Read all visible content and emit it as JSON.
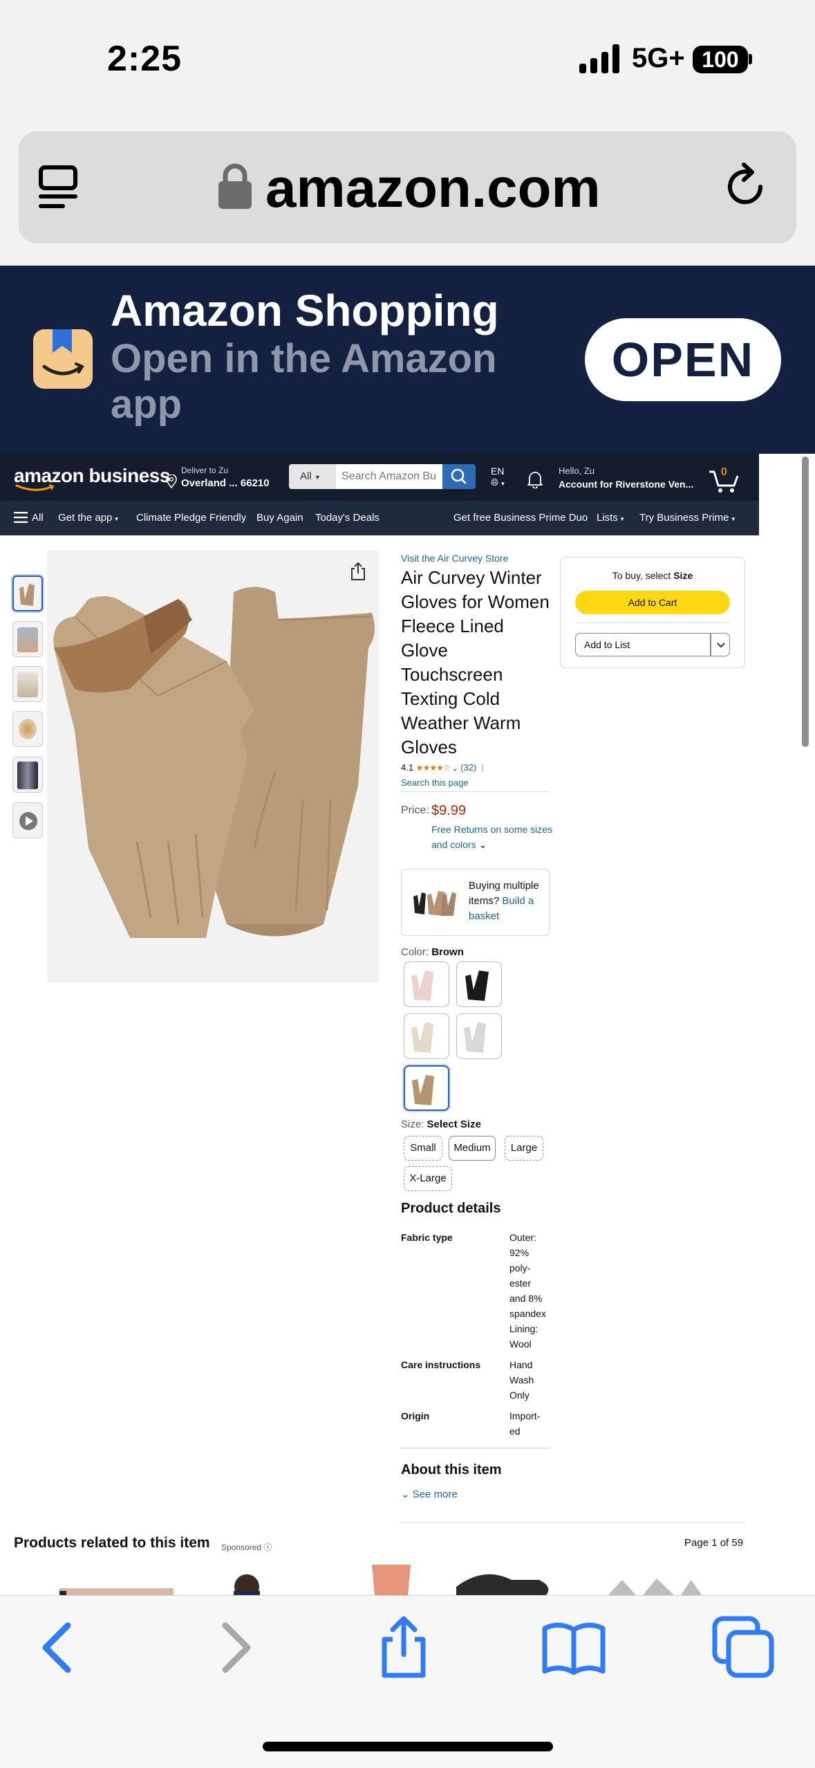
{
  "status": {
    "time": "2:25",
    "network": "5G+",
    "battery": "100"
  },
  "browser": {
    "url": "amazon.com"
  },
  "app_banner": {
    "title": "Amazon Shopping",
    "subtitle": "Open in the Amazon app",
    "open_label": "OPEN"
  },
  "header": {
    "logo": "amazon business",
    "deliver_line1": "Deliver to Zu",
    "deliver_line2": "Overland ... 66210",
    "search_category": "All",
    "search_placeholder": "Search Amazon Bu",
    "lang": "EN",
    "hello_line1": "Hello, Zu",
    "hello_line2": "Account for Riverstone Ven...",
    "cart_count": "0"
  },
  "nav": {
    "all": "All",
    "get_app": "Get the app",
    "climate": "Climate Pledge Friendly",
    "buy_again": "Buy Again",
    "deals": "Today's Deals",
    "prime_duo": "Get free Business Prime Duo",
    "lists": "Lists",
    "try_prime": "Try Business Prime"
  },
  "product": {
    "store": "Visit the Air Curvey Store",
    "title": "Air Curvey Winter Gloves for Women Fleece Lined Glove Touchscreen Texting Cold Weather Warm Gloves",
    "rating": "4.1",
    "review_count": "(32)",
    "search_page": "Search this page",
    "price_label": "Price:",
    "price": "$9.99",
    "returns": "Free Returns on some sizes and colors",
    "multi_text_1": "Buying multiple items?",
    "multi_link": "Build a basket",
    "color_label": "Color:",
    "color_value": "Brown",
    "size_label": "Size:",
    "size_value": "Select Size",
    "sizes": [
      "Small",
      "Medium",
      "Large",
      "X-Large"
    ],
    "details_title": "Product details",
    "specs": [
      {
        "key": "Fabric type",
        "value": "Outer: 92% poly-ester and 8% spandex Lining: Wool"
      },
      {
        "key": "Care instructions",
        "value": "Hand Wash Only"
      },
      {
        "key": "Origin",
        "value": "Import-ed"
      }
    ],
    "about_title": "About this item",
    "see_more": "See more"
  },
  "buybox": {
    "select_prefix": "To buy, select",
    "select_bold": "Size",
    "add_to_cart": "Add to Cart",
    "add_to_list": "Add to List"
  },
  "related": {
    "title": "Products related to this item",
    "sponsored": "Sponsored",
    "page": "Page 1 of 59"
  },
  "colors": {
    "navy": "#142040",
    "header": "#141c2d",
    "price": "#b12704",
    "link": "#2162a1",
    "cart_button": "#ffd814",
    "ios_blue": "#2f7cf6"
  }
}
